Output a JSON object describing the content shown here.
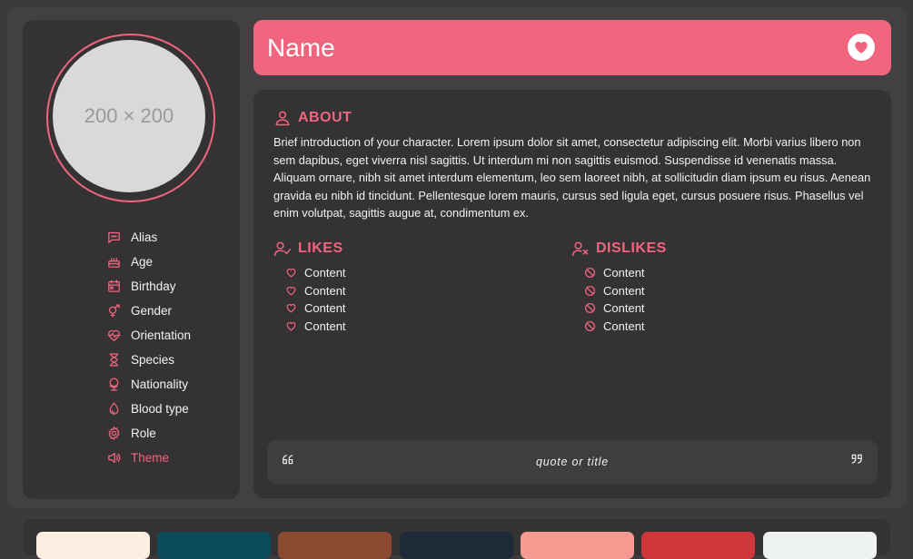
{
  "avatar": {
    "placeholder": "200 × 200"
  },
  "sidebar": {
    "items": [
      {
        "label": "Alias",
        "icon": "chat-bubble-icon"
      },
      {
        "label": "Age",
        "icon": "cake-icon"
      },
      {
        "label": "Birthday",
        "icon": "calendar-icon"
      },
      {
        "label": "Gender",
        "icon": "gender-icon"
      },
      {
        "label": "Orientation",
        "icon": "heart-pulse-icon"
      },
      {
        "label": "Species",
        "icon": "hourglass-icon"
      },
      {
        "label": "Nationality",
        "icon": "globe-icon"
      },
      {
        "label": "Blood type",
        "icon": "droplet-icon"
      },
      {
        "label": "Role",
        "icon": "gear-icon"
      },
      {
        "label": "Theme",
        "icon": "speaker-icon"
      }
    ]
  },
  "header": {
    "title": "Name",
    "button_icon": "heart-icon"
  },
  "about": {
    "title": "ABOUT",
    "text": "Brief introduction of your character. Lorem ipsum dolor sit amet, consectetur adipiscing elit. Morbi varius libero non sem dapibus, eget viverra nisl sagittis. Ut interdum mi non sagittis euismod. Suspendisse id venenatis massa. Aliquam ornare, nibh sit amet interdum elementum, leo sem laoreet nibh, at sollicitudin diam ipsum eu risus. Aenean gravida eu nibh id tincidunt. Pellentesque lorem mauris, cursus sed ligula eget, cursus posuere risus. Phasellus vel enim volutpat, sagittis augue at, condimentum ex."
  },
  "likes": {
    "title": "LIKES",
    "items": [
      "Content",
      "Content",
      "Content",
      "Content"
    ]
  },
  "dislikes": {
    "title": "DISLIKES",
    "items": [
      "Content",
      "Content",
      "Content",
      "Content"
    ]
  },
  "quote": {
    "text": "quote or title"
  },
  "colors": {
    "accent": "#f1647e",
    "panel": "#353234",
    "swatches": [
      "#fdeee2",
      "#0b4b5c",
      "#8c4a32",
      "#1f2a38",
      "#f59a90",
      "#d0373b",
      "#eef3f2"
    ]
  }
}
